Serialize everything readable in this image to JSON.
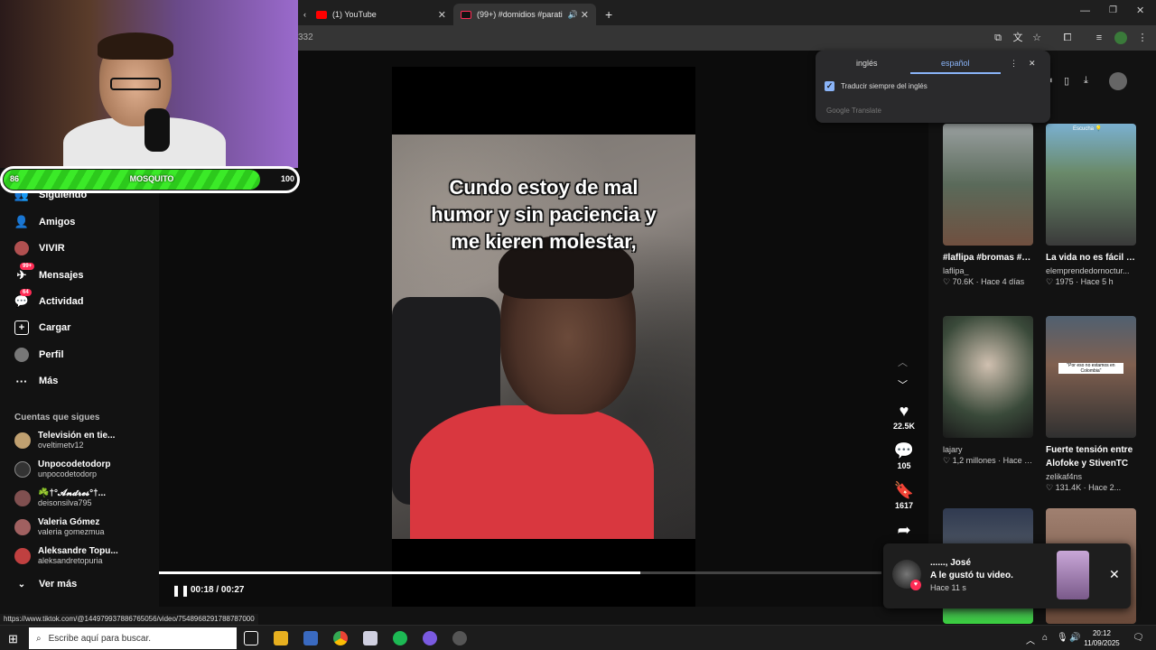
{
  "browser": {
    "tabs": [
      {
        "title": "(1) YouTube",
        "active": false
      },
      {
        "title": "(99+) #domidios #parati",
        "active": true
      }
    ],
    "new_tab": "+",
    "url_partial": "332",
    "status_url": "https://www.tiktok.com/@144979937886765056/video/7548968291788787000"
  },
  "translate": {
    "lang_from": "inglés",
    "lang_to": "español",
    "always_label": "Traducir siempre del inglés",
    "always_checked": true,
    "branding": "Google Translate"
  },
  "webcam_overlay": {
    "level": "86",
    "name": "MOSQUITO",
    "max": "100",
    "fill_fraction": 0.86
  },
  "sidebar": {
    "nav": [
      {
        "label": "Siguiendo",
        "icon": "following-icon"
      },
      {
        "label": "Amigos",
        "icon": "friends-icon"
      },
      {
        "label": "VIVIR",
        "icon": "live-icon"
      },
      {
        "label": "Mensajes",
        "icon": "messages-icon",
        "badge": "99+"
      },
      {
        "label": "Actividad",
        "icon": "activity-icon",
        "badge": "64"
      },
      {
        "label": "Cargar",
        "icon": "upload-icon"
      },
      {
        "label": "Perfil",
        "icon": "profile-icon"
      },
      {
        "label": "Más",
        "icon": "more-icon"
      }
    ],
    "following_title": "Cuentas que sigues",
    "following": [
      {
        "name": "Televisión en tie...",
        "handle": "oveltimetv12"
      },
      {
        "name": "Unpocodetodorp",
        "handle": "unpocodetodorp"
      },
      {
        "name": "☘️†°𝓐𝓷𝓭𝓻𝓮𝓼°†...",
        "handle": "deisonsilva795"
      },
      {
        "name": "Valeria Gómez",
        "handle": "valeria gomezmua"
      },
      {
        "name": "Aleksandre Topu...",
        "handle": "aleksandretopuria"
      }
    ],
    "see_more": "Ver más"
  },
  "video": {
    "caption_lines": [
      "Cundo estoy de mal",
      "humor y sin paciencia y",
      "me kieren  molestar,"
    ],
    "time": "00:18 / 00:27",
    "progress": 0.6667,
    "likes": "22.5K",
    "comments": "105",
    "saves": "1617"
  },
  "recommendations": [
    {
      "caption": "#laflipa #bromas #tikto #tendencias...",
      "author": "laflipa_",
      "views": "70.6K",
      "age": "Hace 4 días",
      "col": 0,
      "row": 0
    },
    {
      "caption": "La vida no es fácil 😩 #elemprendedorno...",
      "author": "elemprendedornoctur...",
      "views": "1975",
      "age": "Hace 5 h",
      "col": 1,
      "row": 0
    },
    {
      "caption": "",
      "author": "lajary",
      "views": "1,2 millones",
      "age": "Hace 2...",
      "col": 0,
      "row": 1
    },
    {
      "caption": "Fuerte tensión entre Alofoke y StivenTC ...",
      "author": "zelikaf4ns",
      "views": "131.4K",
      "age": "Hace 2...",
      "col": 1,
      "row": 1
    }
  ],
  "thumb_text": {
    "thumb4": "\"Por eso no estamos en Colombia\"",
    "thumb2": "Escucha 💡"
  },
  "notification": {
    "user": "......, José",
    "message": "A le gustó tu video.",
    "time": "Hace 11 s"
  },
  "taskbar": {
    "search_placeholder": "Escribe aquí para buscar.",
    "time": "20:12",
    "date": "11/09/2025"
  },
  "colors": {
    "accent": "#fe2c55",
    "progress": "#ffffff",
    "hp": "#3bea28"
  }
}
